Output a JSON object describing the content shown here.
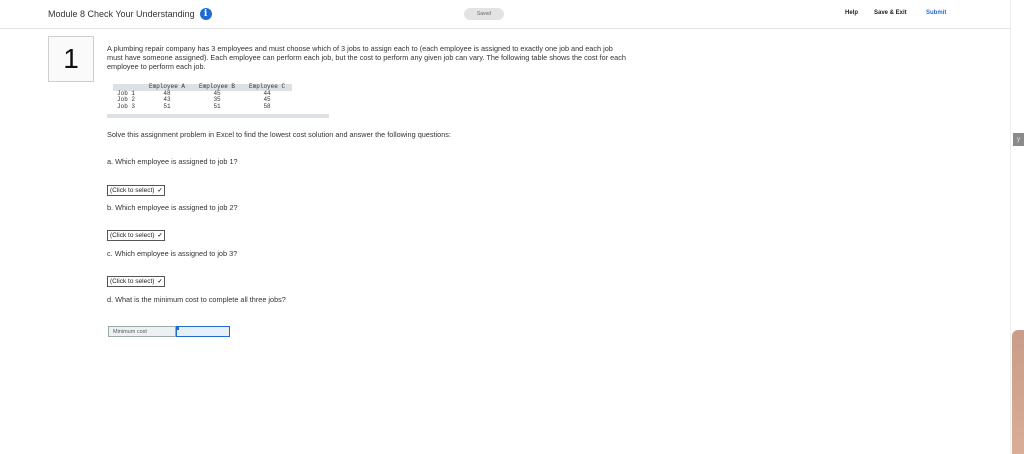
{
  "header": {
    "title": "Module 8 Check Your Understanding",
    "info_icon": "i",
    "saved_label": "Saved",
    "help_label": "Help",
    "save_exit_label": "Save & Exit",
    "submit_label": "Submit"
  },
  "question": {
    "number": "1",
    "text": "A plumbing repair company has 3 employees and must choose which of 3 jobs to assign each to (each employee is assigned to exactly one job and each job must have someone assigned). Each employee can perform each job, but the cost to perform any given job can vary. The following table shows the cost for each employee to perform each job.",
    "table": {
      "headers": [
        "",
        "Employee A",
        "Employee B",
        "Employee C"
      ],
      "rows": [
        [
          "Job 1",
          "48",
          "45",
          "44"
        ],
        [
          "Job 2",
          "43",
          "35",
          "45"
        ],
        [
          "Job 3",
          "51",
          "51",
          "58"
        ]
      ]
    },
    "instruction": "Solve this assignment problem in Excel to find the lowest cost solution and answer the following questions:",
    "parts": [
      {
        "label": "a. Which employee is assigned to job 1?",
        "select_value": "(Click to select)"
      },
      {
        "label": "b. Which employee is assigned to job 2?",
        "select_value": "(Click to select)"
      },
      {
        "label": "c. Which employee is assigned to job 3?",
        "select_value": "(Click to select)"
      },
      {
        "label": "d. What is the minimum cost to complete all three jobs?"
      }
    ],
    "min_cost_label": "Minimum cost",
    "min_cost_value": ""
  },
  "side_tab_label": "y",
  "colors": {
    "accent": "#1f6bd6",
    "table_header": "#dde1e6"
  }
}
